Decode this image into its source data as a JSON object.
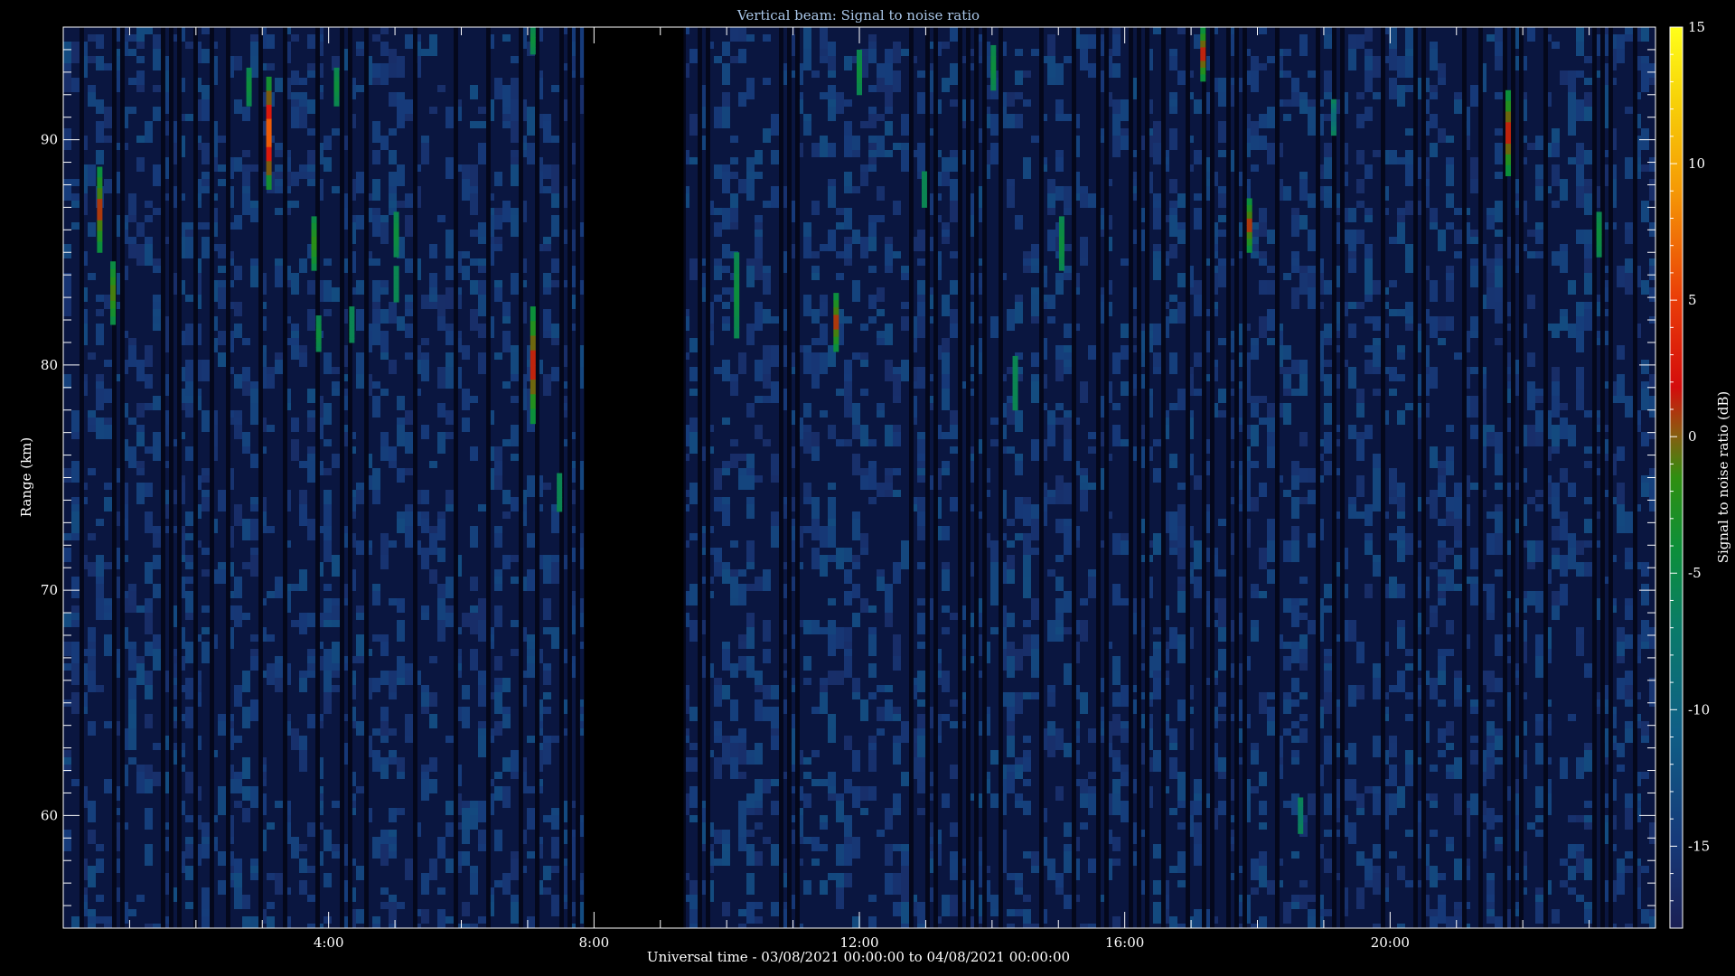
{
  "chart_data": {
    "type": "heatmap",
    "title": "Vertical beam: Signal to noise ratio",
    "xlabel": "Universal time - 03/08/2021 00:00:00 to 04/08/2021 00:00:00",
    "ylabel": "Range (km)",
    "colorbar_label": "Signal to noise ratio (dB)",
    "xlim": [
      0,
      24
    ],
    "ylim": [
      55,
      95
    ],
    "clim": [
      -18,
      15
    ],
    "x_ticks": [
      {
        "value": 4,
        "label": "4:00"
      },
      {
        "value": 8,
        "label": "8:00"
      },
      {
        "value": 12,
        "label": "12:00"
      },
      {
        "value": 16,
        "label": "16:00"
      },
      {
        "value": 20,
        "label": "20:00"
      }
    ],
    "y_ticks": [
      {
        "value": 60,
        "label": "60"
      },
      {
        "value": 70,
        "label": "70"
      },
      {
        "value": 80,
        "label": "80"
      },
      {
        "value": 90,
        "label": "90"
      }
    ],
    "colorbar_ticks": [
      {
        "value": 15,
        "label": "15"
      },
      {
        "value": 10,
        "label": "10"
      },
      {
        "value": 5,
        "label": "5"
      },
      {
        "value": 0,
        "label": "0"
      },
      {
        "value": -5,
        "label": "-5"
      },
      {
        "value": -10,
        "label": "-10"
      },
      {
        "value": -15,
        "label": "-15"
      }
    ],
    "background_snr_db": -16,
    "data_gap_hours": [
      7.85,
      9.35
    ],
    "echoes": [
      {
        "t": 0.55,
        "r_min": 85.0,
        "r_max": 88.8,
        "snr_peak": 1
      },
      {
        "t": 0.75,
        "r_min": 81.8,
        "r_max": 84.6,
        "snr_peak": -1
      },
      {
        "t": 2.8,
        "r_min": 91.5,
        "r_max": 93.2,
        "snr_peak": -5
      },
      {
        "t": 3.1,
        "r_min": 87.8,
        "r_max": 92.8,
        "snr_peak": 8
      },
      {
        "t": 3.78,
        "r_min": 84.2,
        "r_max": 86.6,
        "snr_peak": -2
      },
      {
        "t": 3.85,
        "r_min": 80.6,
        "r_max": 82.2,
        "snr_peak": -5
      },
      {
        "t": 4.12,
        "r_min": 91.5,
        "r_max": 93.2,
        "snr_peak": -5
      },
      {
        "t": 4.35,
        "r_min": 81.0,
        "r_max": 82.6,
        "snr_peak": -6
      },
      {
        "t": 5.02,
        "r_min": 84.8,
        "r_max": 86.8,
        "snr_peak": -5
      },
      {
        "t": 5.02,
        "r_min": 82.8,
        "r_max": 84.4,
        "snr_peak": -6
      },
      {
        "t": 7.08,
        "r_min": 93.8,
        "r_max": 95.0,
        "snr_peak": -5
      },
      {
        "t": 7.08,
        "r_min": 77.4,
        "r_max": 82.6,
        "snr_peak": 2
      },
      {
        "t": 7.48,
        "r_min": 73.5,
        "r_max": 75.2,
        "snr_peak": -6
      },
      {
        "t": 10.15,
        "r_min": 81.2,
        "r_max": 85.0,
        "snr_peak": -5
      },
      {
        "t": 11.65,
        "r_min": 80.6,
        "r_max": 83.2,
        "snr_peak": 1
      },
      {
        "t": 12.0,
        "r_min": 92.0,
        "r_max": 94.0,
        "snr_peak": -5
      },
      {
        "t": 12.98,
        "r_min": 87.0,
        "r_max": 88.6,
        "snr_peak": -6
      },
      {
        "t": 14.02,
        "r_min": 92.2,
        "r_max": 94.2,
        "snr_peak": -5
      },
      {
        "t": 14.35,
        "r_min": 78.0,
        "r_max": 80.4,
        "snr_peak": -6
      },
      {
        "t": 15.05,
        "r_min": 84.2,
        "r_max": 86.6,
        "snr_peak": -5
      },
      {
        "t": 17.18,
        "r_min": 92.6,
        "r_max": 95.0,
        "snr_peak": 2
      },
      {
        "t": 17.88,
        "r_min": 85.0,
        "r_max": 87.4,
        "snr_peak": 1
      },
      {
        "t": 21.78,
        "r_min": 88.4,
        "r_max": 92.2,
        "snr_peak": 2
      },
      {
        "t": 23.15,
        "r_min": 84.8,
        "r_max": 86.8,
        "snr_peak": -5
      },
      {
        "t": 18.65,
        "r_min": 59.2,
        "r_max": 60.8,
        "snr_peak": -7
      },
      {
        "t": 19.15,
        "r_min": 90.2,
        "r_max": 91.8,
        "snr_peak": -9
      }
    ]
  }
}
